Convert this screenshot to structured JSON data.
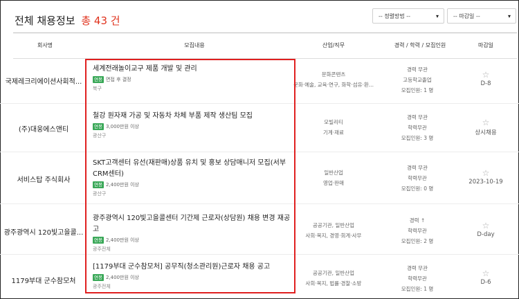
{
  "header": {
    "title": "전체 채용정보",
    "count_label": "총 43 건"
  },
  "filters": {
    "sort": "-- 정렬방법 --",
    "deadline": "-- 마감일 --"
  },
  "columns": {
    "company": "회사명",
    "content": "모집내용",
    "industry": "산업/직무",
    "requirements": "경력 / 학력 / 모집인원",
    "deadline": "마감일"
  },
  "rows": [
    {
      "company": "국제레크리에이션사회적...",
      "title": "세계전래놀이교구 제품 개발 및 관리",
      "salary_badge": "연봉",
      "salary": "면접 후 결정",
      "location": "북구",
      "industry1": "문화콘텐츠",
      "industry2": "문화·예술, 교육·연구, 화학·섬유·환...",
      "exp": "경력 무관",
      "edu": "고등학교졸업",
      "recruit": "모집인원: 1 명",
      "star": "☆",
      "deadline": "D-8"
    },
    {
      "company": "(주)대웅에스앤티",
      "title": "철강 원자재 가공 및 자동차 차체 부품 제작 생산팀 모집",
      "salary_badge": "연봉",
      "salary": "3,000만원 이상",
      "location": "광산구",
      "industry1": "모빌리티",
      "industry2": "기계·재료",
      "exp": "경력 무관",
      "edu": "학력무관",
      "recruit": "모집인원: 3 명",
      "star": "☆",
      "deadline": "상시채용"
    },
    {
      "company": "서비스탑 주식회사",
      "title": "SKT고객센터 유선(재판매)상품 유치 및 홍보 상담매니저 모집(서부CRM센터)",
      "salary_badge": "연봉",
      "salary": "2,400만원 이상",
      "location": "광산구",
      "industry1": "일반산업",
      "industry2": "영업·판매",
      "exp": "경력 무관",
      "edu": "학력무관",
      "recruit": "모집인원: 0 명",
      "star": "☆",
      "deadline": "2023-10-19"
    },
    {
      "company": "광주광역시 120빛고을콜...",
      "title": "광주광역시 120빛고을콜센터 기간제 근로자(상담원) 채용 변경 재공고",
      "salary_badge": "연봉",
      "salary": "2,400만원 이상",
      "location": "광주전체",
      "industry1": "공공기관, 일반산업",
      "industry2": "사회·복지, 경영·회계·사무",
      "exp": "경력 ↑",
      "edu": "학력무관",
      "recruit": "모집인원: 2 명",
      "star": "☆",
      "deadline": "D-day"
    },
    {
      "company": "1179부대 군수참모처",
      "title": "[1179부대 군수참모처] 공무직(청소관리원)근로자 채용 공고",
      "salary_badge": "연봉",
      "salary": "2,400만원 이상",
      "location": "광주전체",
      "industry1": "공공기관, 일반산업",
      "industry2": "사회·복지, 법률·경찰·소방",
      "exp": "경력 무관",
      "edu": "학력무관",
      "recruit": "모집인원: 1 명",
      "star": "☆",
      "deadline": "D-6"
    }
  ]
}
